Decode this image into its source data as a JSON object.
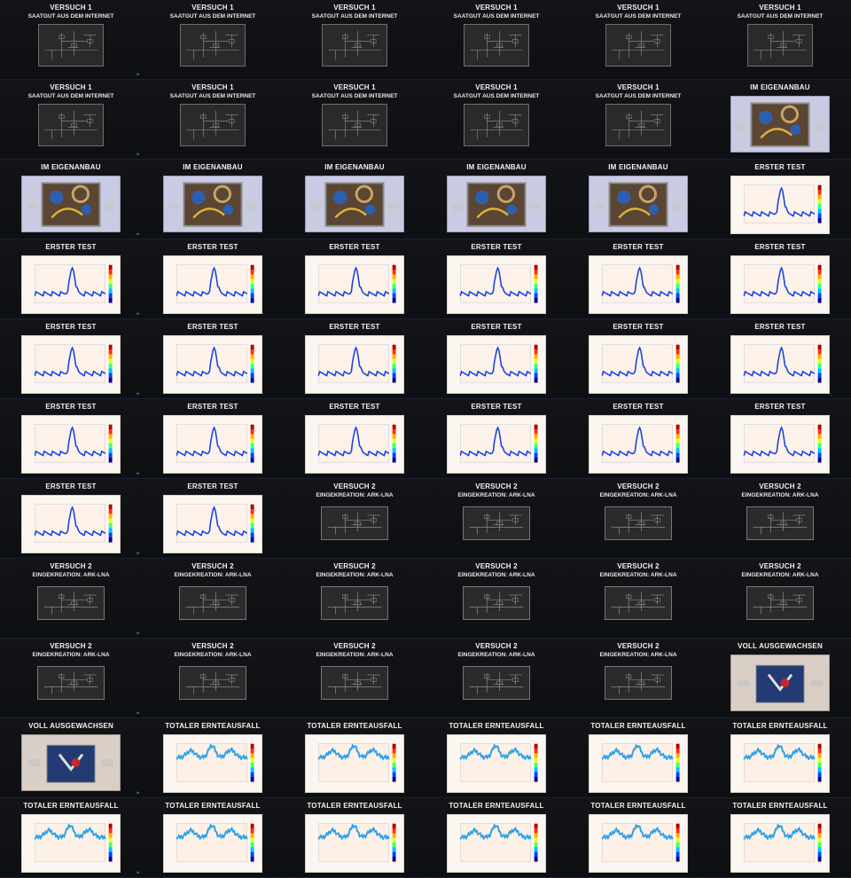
{
  "thumbnails": [
    {
      "kind": "schem1",
      "title": "VERSUCH 1",
      "subtitle": "SAATGUT AUS DEM INTERNET"
    },
    {
      "kind": "schem1",
      "title": "VERSUCH 1",
      "subtitle": "SAATGUT AUS DEM INTERNET"
    },
    {
      "kind": "schem1",
      "title": "VERSUCH 1",
      "subtitle": "SAATGUT AUS DEM INTERNET"
    },
    {
      "kind": "schem1",
      "title": "VERSUCH 1",
      "subtitle": "SAATGUT AUS DEM INTERNET"
    },
    {
      "kind": "schem1",
      "title": "VERSUCH 1",
      "subtitle": "SAATGUT AUS DEM INTERNET"
    },
    {
      "kind": "schem1",
      "title": "VERSUCH 1",
      "subtitle": "SAATGUT AUS DEM INTERNET"
    },
    {
      "kind": "schem1",
      "title": "VERSUCH 1",
      "subtitle": "SAATGUT AUS DEM INTERNET"
    },
    {
      "kind": "schem1",
      "title": "VERSUCH 1",
      "subtitle": "SAATGUT AUS DEM INTERNET"
    },
    {
      "kind": "schem1",
      "title": "VERSUCH 1",
      "subtitle": "SAATGUT AUS DEM INTERNET"
    },
    {
      "kind": "schem1",
      "title": "VERSUCH 1",
      "subtitle": "SAATGUT AUS DEM INTERNET"
    },
    {
      "kind": "schem1",
      "title": "VERSUCH 1",
      "subtitle": "SAATGUT AUS DEM INTERNET"
    },
    {
      "kind": "photo",
      "title": "IM EIGENANBAU",
      "subtitle": ""
    },
    {
      "kind": "photo",
      "title": "IM EIGENANBAU",
      "subtitle": ""
    },
    {
      "kind": "photo",
      "title": "IM EIGENANBAU",
      "subtitle": ""
    },
    {
      "kind": "photo",
      "title": "IM EIGENANBAU",
      "subtitle": ""
    },
    {
      "kind": "photo",
      "title": "IM EIGENANBAU",
      "subtitle": ""
    },
    {
      "kind": "photo",
      "title": "IM EIGENANBAU",
      "subtitle": ""
    },
    {
      "kind": "spec",
      "title": "ERSTER TEST",
      "subtitle": ""
    },
    {
      "kind": "spec",
      "title": "ERSTER TEST",
      "subtitle": ""
    },
    {
      "kind": "spec",
      "title": "ERSTER TEST",
      "subtitle": ""
    },
    {
      "kind": "spec",
      "title": "ERSTER TEST",
      "subtitle": ""
    },
    {
      "kind": "spec",
      "title": "ERSTER TEST",
      "subtitle": ""
    },
    {
      "kind": "spec",
      "title": "ERSTER TEST",
      "subtitle": ""
    },
    {
      "kind": "spec",
      "title": "ERSTER TEST",
      "subtitle": ""
    },
    {
      "kind": "spec",
      "title": "ERSTER TEST",
      "subtitle": ""
    },
    {
      "kind": "spec",
      "title": "ERSTER TEST",
      "subtitle": ""
    },
    {
      "kind": "spec",
      "title": "ERSTER TEST",
      "subtitle": ""
    },
    {
      "kind": "spec",
      "title": "ERSTER TEST",
      "subtitle": ""
    },
    {
      "kind": "spec",
      "title": "ERSTER TEST",
      "subtitle": ""
    },
    {
      "kind": "spec",
      "title": "ERSTER TEST",
      "subtitle": ""
    },
    {
      "kind": "spec",
      "title": "ERSTER TEST",
      "subtitle": ""
    },
    {
      "kind": "spec",
      "title": "ERSTER TEST",
      "subtitle": ""
    },
    {
      "kind": "spec",
      "title": "ERSTER TEST",
      "subtitle": ""
    },
    {
      "kind": "spec",
      "title": "ERSTER TEST",
      "subtitle": ""
    },
    {
      "kind": "spec",
      "title": "ERSTER TEST",
      "subtitle": ""
    },
    {
      "kind": "spec",
      "title": "ERSTER TEST",
      "subtitle": ""
    },
    {
      "kind": "spec",
      "title": "ERSTER TEST",
      "subtitle": ""
    },
    {
      "kind": "spec",
      "title": "ERSTER TEST",
      "subtitle": ""
    },
    {
      "kind": "schem2",
      "title": "VERSUCH 2",
      "subtitle": "EINGEKREATION: ARK-LNA"
    },
    {
      "kind": "schem2",
      "title": "VERSUCH 2",
      "subtitle": "EINGEKREATION: ARK-LNA"
    },
    {
      "kind": "schem2",
      "title": "VERSUCH 2",
      "subtitle": "EINGEKREATION: ARK-LNA"
    },
    {
      "kind": "schem2",
      "title": "VERSUCH 2",
      "subtitle": "EINGEKREATION: ARK-LNA"
    },
    {
      "kind": "schem2",
      "title": "VERSUCH 2",
      "subtitle": "EINGEKREATION: ARK-LNA"
    },
    {
      "kind": "schem2",
      "title": "VERSUCH 2",
      "subtitle": "EINGEKREATION: ARK-LNA"
    },
    {
      "kind": "schem2",
      "title": "VERSUCH 2",
      "subtitle": "EINGEKREATION: ARK-LNA"
    },
    {
      "kind": "schem2",
      "title": "VERSUCH 2",
      "subtitle": "EINGEKREATION: ARK-LNA"
    },
    {
      "kind": "schem2",
      "title": "VERSUCH 2",
      "subtitle": "EINGEKREATION: ARK-LNA"
    },
    {
      "kind": "schem2",
      "title": "VERSUCH 2",
      "subtitle": "EINGEKREATION: ARK-LNA"
    },
    {
      "kind": "schem2",
      "title": "VERSUCH 2",
      "subtitle": "EINGEKREATION: ARK-LNA"
    },
    {
      "kind": "schem2",
      "title": "VERSUCH 2",
      "subtitle": "EINGEKREATION: ARK-LNA"
    },
    {
      "kind": "schem2",
      "title": "VERSUCH 2",
      "subtitle": "EINGEKREATION: ARK-LNA"
    },
    {
      "kind": "schem2",
      "title": "VERSUCH 2",
      "subtitle": "EINGEKREATION: ARK-LNA"
    },
    {
      "kind": "schem2",
      "title": "VERSUCH 2",
      "subtitle": "EINGEKREATION: ARK-LNA"
    },
    {
      "kind": "board",
      "title": "VOLL AUSGEWACHSEN",
      "subtitle": ""
    },
    {
      "kind": "board",
      "title": "VOLL AUSGEWACHSEN",
      "subtitle": ""
    },
    {
      "kind": "spec2",
      "title": "TOTALER ERNTEAUSFALL",
      "subtitle": ""
    },
    {
      "kind": "spec2",
      "title": "TOTALER ERNTEAUSFALL",
      "subtitle": ""
    },
    {
      "kind": "spec2",
      "title": "TOTALER ERNTEAUSFALL",
      "subtitle": ""
    },
    {
      "kind": "spec2",
      "title": "TOTALER ERNTEAUSFALL",
      "subtitle": ""
    },
    {
      "kind": "spec2",
      "title": "TOTALER ERNTEAUSFALL",
      "subtitle": ""
    },
    {
      "kind": "spec2",
      "title": "TOTALER ERNTEAUSFALL",
      "subtitle": ""
    },
    {
      "kind": "spec2",
      "title": "TOTALER ERNTEAUSFALL",
      "subtitle": ""
    },
    {
      "kind": "spec2",
      "title": "TOTALER ERNTEAUSFALL",
      "subtitle": ""
    },
    {
      "kind": "spec2",
      "title": "TOTALER ERNTEAUSFALL",
      "subtitle": ""
    },
    {
      "kind": "spec2",
      "title": "TOTALER ERNTEAUSFALL",
      "subtitle": ""
    },
    {
      "kind": "spec2",
      "title": "TOTALER ERNTEAUSFALL",
      "subtitle": ""
    }
  ],
  "colors": {
    "background": "#0f1114",
    "link_icon": "#3f6fd0",
    "title_text": "#f2f2f2"
  },
  "icons": {
    "link": "link-icon"
  }
}
